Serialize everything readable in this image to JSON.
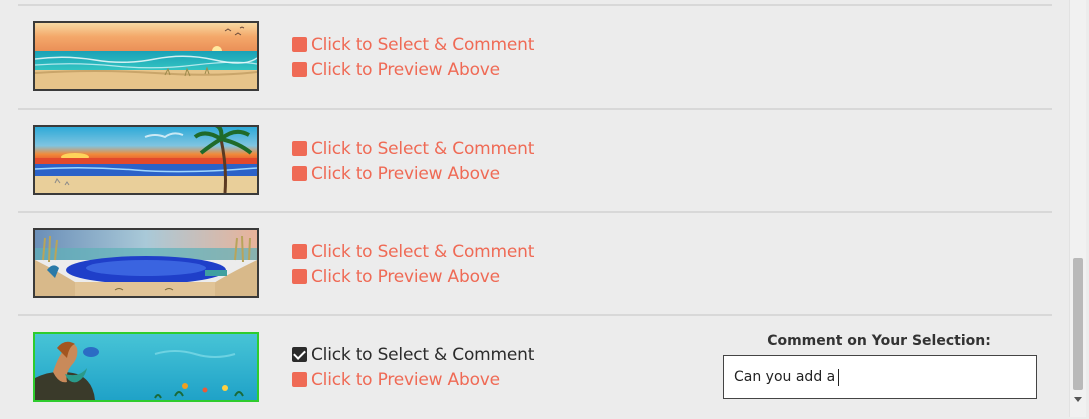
{
  "selections": [
    {
      "select_label": "Click to Select & Comment",
      "preview_label": "Click to Preview Above",
      "selected": false
    },
    {
      "select_label": "Click to Select & Comment",
      "preview_label": "Click to Preview Above",
      "selected": false
    },
    {
      "select_label": "Click to Select & Comment",
      "preview_label": "Click to Preview Above",
      "selected": false
    },
    {
      "select_label": "Click to Select & Comment",
      "preview_label": "Click to Preview Above",
      "selected": true
    }
  ],
  "comment": {
    "label": "Comment on Your Selection:",
    "value": "Can you add a"
  },
  "colors": {
    "link": "#ef6a55",
    "checked_text": "#2b2b2b",
    "selected_border": "#2ecc2e",
    "background": "#ececec"
  },
  "icons": {
    "unchecked": "square-icon",
    "checked": "checkbox-checked-icon"
  }
}
